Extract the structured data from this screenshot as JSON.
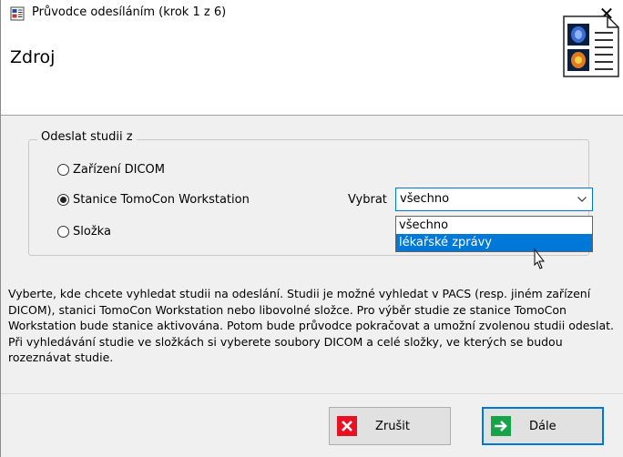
{
  "titlebar": {
    "title": "Průvodce odesíláním (krok 1 z 6)",
    "close": "✕"
  },
  "header": {
    "title": "Zdroj"
  },
  "group": {
    "label": "Odeslat studii z",
    "options": [
      {
        "label": "Zařízení DICOM",
        "selected": false
      },
      {
        "label": "Stanice TomoCon Workstation",
        "selected": true
      },
      {
        "label": "Složka",
        "selected": false
      }
    ]
  },
  "select": {
    "label": "Vybrat",
    "value": "všechno",
    "options": [
      "všechno",
      "lékařské zprávy"
    ],
    "highlighted_index": 1
  },
  "description": "Vyberte, kde chcete vyhledat studii na odeslání. Studii je možné vyhledat v PACS (resp. jiném zařízení DICOM), stanici TomoCon Workstation nebo libovolné složce. Pro výběr studie ze stanice TomoCon Workstation bude stanice aktivována. Potom bude průvodce pokračovat a umožní zvolenou studii odeslat. Při vyhledávání studie ve složkách si vyberete soubory DICOM a celé složky, ve kterých se budou rozeznávat studie.",
  "buttons": {
    "cancel": {
      "label": "Zrušit",
      "icon": "red-x-icon"
    },
    "next": {
      "label": "Dále",
      "icon": "green-arrow-icon"
    }
  },
  "colors": {
    "accent": "#0078d7",
    "cancel_icon": "#e81123",
    "next_icon": "#16a34a"
  }
}
